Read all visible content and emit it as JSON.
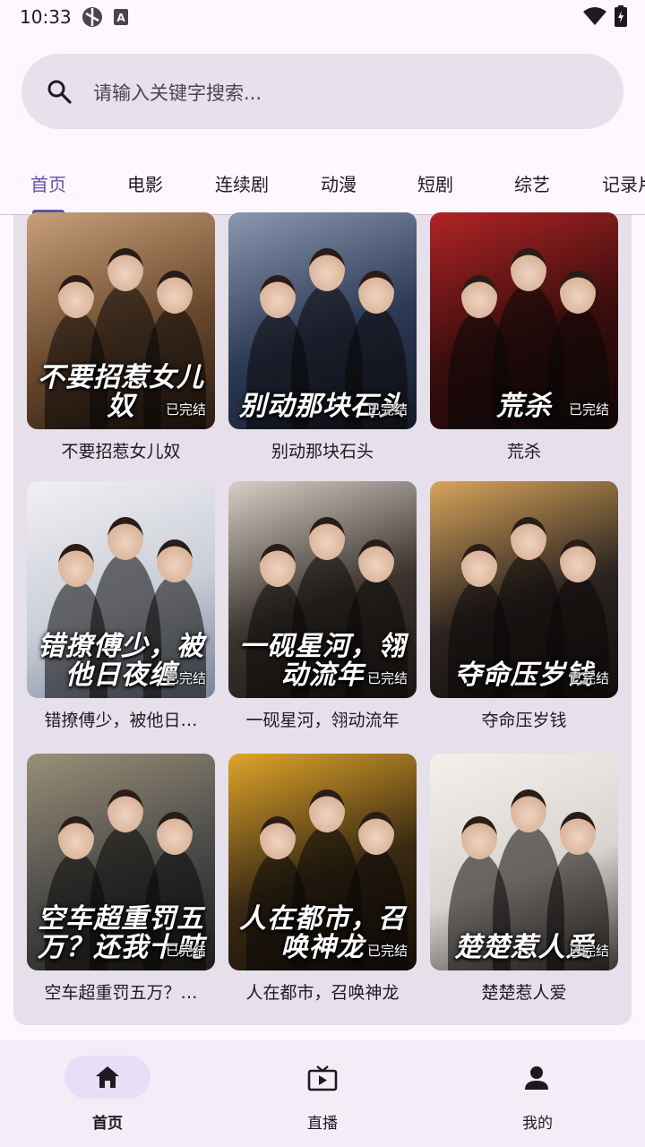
{
  "status_bar": {
    "time": "10:33"
  },
  "search": {
    "placeholder": "请输入关键字搜索..."
  },
  "tabs": [
    {
      "label": "首页",
      "active": true
    },
    {
      "label": "电影"
    },
    {
      "label": "连续剧"
    },
    {
      "label": "动漫"
    },
    {
      "label": "短剧"
    },
    {
      "label": "综艺"
    },
    {
      "label": "记录片"
    }
  ],
  "items": [
    {
      "title": "不要招惹女儿奴",
      "poster_text": "不要招惹女儿奴",
      "badge": "已完结",
      "colors": [
        "#6b4a2e",
        "#c8a07a",
        "#2a1a10"
      ]
    },
    {
      "title": "别动那块石头",
      "poster_text": "别动那块石头",
      "badge": "已完结",
      "colors": [
        "#2c3a55",
        "#8a98b0",
        "#15192a"
      ]
    },
    {
      "title": "荒杀",
      "poster_text": "荒杀",
      "badge": "已完结",
      "colors": [
        "#3a0d0d",
        "#b02424",
        "#140606"
      ]
    },
    {
      "title": "错撩傅少，被他日…",
      "poster_text": "错撩傅少，被他日夜缠",
      "badge": "已完结",
      "colors": [
        "#c9ced8",
        "#f2f0f2",
        "#7a8498"
      ]
    },
    {
      "title": "一砚星河，翎动流年",
      "poster_text": "一砚星河，翎动流年",
      "badge": "已完结",
      "colors": [
        "#3b342f",
        "#d8d0c6",
        "#1a1614"
      ]
    },
    {
      "title": "夺命压岁钱",
      "poster_text": "夺命压岁钱",
      "badge": "已完结",
      "colors": [
        "#2a2320",
        "#d8a45a",
        "#120e0c"
      ]
    },
    {
      "title": "空车超重罚五万？…",
      "poster_text": "空车超重罚五万？还我十吨",
      "badge": "已完结",
      "colors": [
        "#4a4a48",
        "#9a8f78",
        "#1c1c1a"
      ]
    },
    {
      "title": "人在都市，召唤神龙",
      "poster_text": "人在都市，召唤神龙",
      "badge": "已完结",
      "colors": [
        "#3a2a12",
        "#e0a52a",
        "#120c06"
      ]
    },
    {
      "title": "楚楚惹人爱",
      "poster_text": "楚楚惹人爱",
      "badge": "已完结",
      "colors": [
        "#d9d4cf",
        "#f4f0ec",
        "#3a3430"
      ]
    }
  ],
  "bottom_nav": [
    {
      "label": "首页",
      "icon": "home-icon",
      "active": true
    },
    {
      "label": "直播",
      "icon": "tv-icon"
    },
    {
      "label": "我的",
      "icon": "person-icon"
    }
  ],
  "theme": {
    "accent": "#6750a4",
    "surface": "#fef7ff",
    "panel": "#e6e0ea",
    "search_bg": "#e8e1ec"
  }
}
